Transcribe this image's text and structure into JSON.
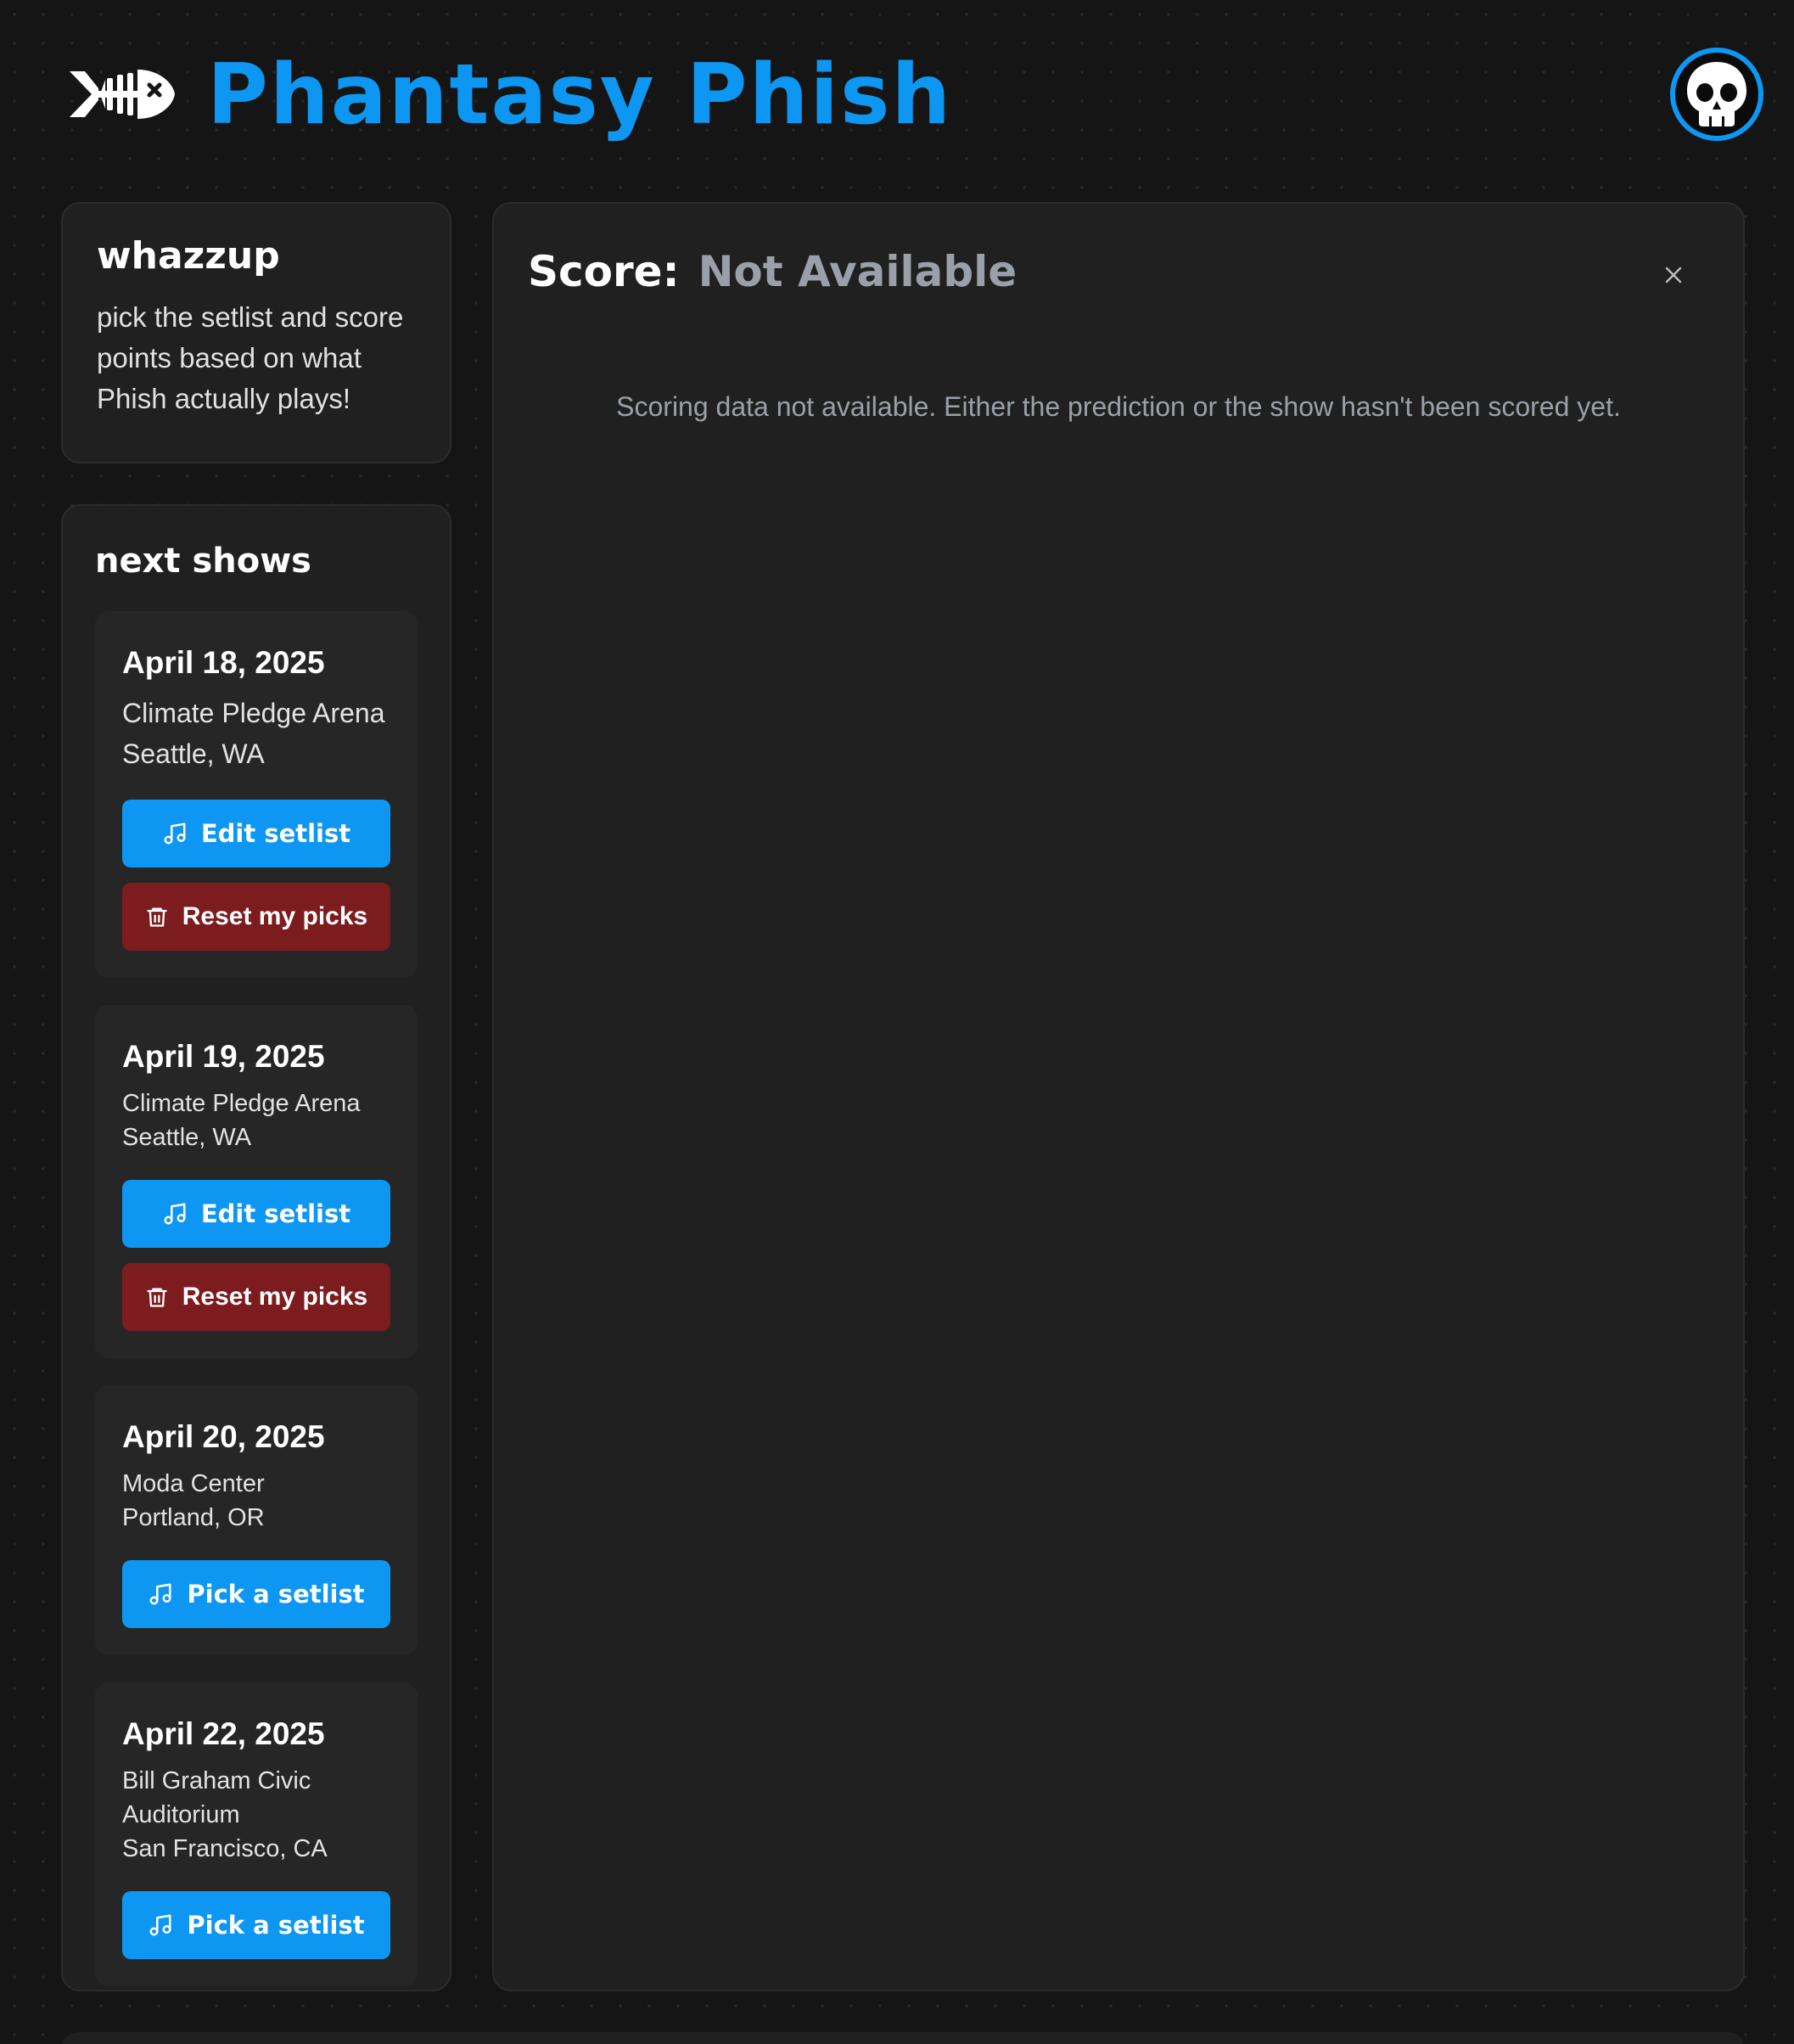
{
  "header": {
    "title": "Phantasy Phish",
    "logo_icon": "fish-skeleton-icon",
    "avatar_icon": "skull-icon",
    "accent_color": "#0d97f2"
  },
  "intro": {
    "heading": "whazzup",
    "body": "pick the setlist and score points based on what Phish actually plays!"
  },
  "shows_panel": {
    "heading": "next shows",
    "shows": [
      {
        "date": "April 18, 2025",
        "venue": "Climate Pledge Arena",
        "location": "Seattle, WA",
        "primary_action": "Edit setlist",
        "secondary_action": "Reset my picks"
      },
      {
        "date": "April 19, 2025",
        "venue": "Climate Pledge Arena",
        "location": "Seattle, WA",
        "primary_action": "Edit setlist",
        "secondary_action": "Reset my picks"
      },
      {
        "date": "April 20, 2025",
        "venue": "Moda Center",
        "location": "Portland, OR",
        "primary_action": "Pick a setlist"
      },
      {
        "date": "April 22, 2025",
        "venue": "Bill Graham Civic Auditorium",
        "location": "San Francisco, CA",
        "primary_action": "Pick a setlist"
      }
    ]
  },
  "score_panel": {
    "label": "Score:",
    "value": "Not Available",
    "message": "Scoring data not available. Either the prediction or the show hasn't been scored yet.",
    "close_label": "×"
  }
}
